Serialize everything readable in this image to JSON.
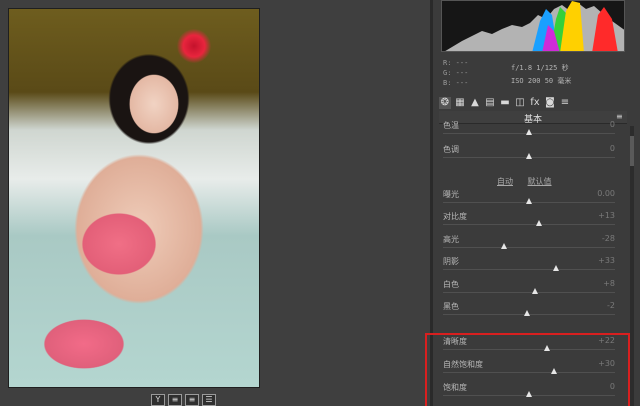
{
  "canvas": {
    "bottom_buttons": [
      "Y",
      "≡",
      "≡",
      "☰"
    ]
  },
  "panel": {
    "readout": {
      "r": "R: ---",
      "g": "G: ---",
      "b": "B: ---",
      "exposure": "f/1.8  1/125 秒",
      "iso": "ISO 200  50 毫米"
    },
    "tabs": [
      "❂",
      "▦",
      "▲",
      "▤",
      "▬",
      "◫",
      "fx",
      "◙",
      "≡"
    ],
    "section_title": "基本",
    "sliders": [
      {
        "label": "色温",
        "value": "0",
        "pos": 0.5
      },
      {
        "label": "色调",
        "value": "0",
        "pos": 0.5
      },
      {
        "label": "曝光",
        "value": "0.00",
        "pos": 0.5
      },
      {
        "label": "对比度",
        "value": "+13",
        "pos": 0.56
      },
      {
        "label": "高光",
        "value": "-28",
        "pos": 0.36
      },
      {
        "label": "阴影",
        "value": "+33",
        "pos": 0.66
      },
      {
        "label": "白色",
        "value": "+8",
        "pos": 0.54
      },
      {
        "label": "黑色",
        "value": "-2",
        "pos": 0.49
      },
      {
        "label": "清晰度",
        "value": "+22",
        "pos": 0.61
      },
      {
        "label": "自然饱和度",
        "value": "+30",
        "pos": 0.65
      },
      {
        "label": "饱和度",
        "value": "0",
        "pos": 0.5
      }
    ],
    "auto_label": "自动",
    "default_label": "默认值"
  },
  "colors": {
    "highlight": "#d91f1f"
  }
}
